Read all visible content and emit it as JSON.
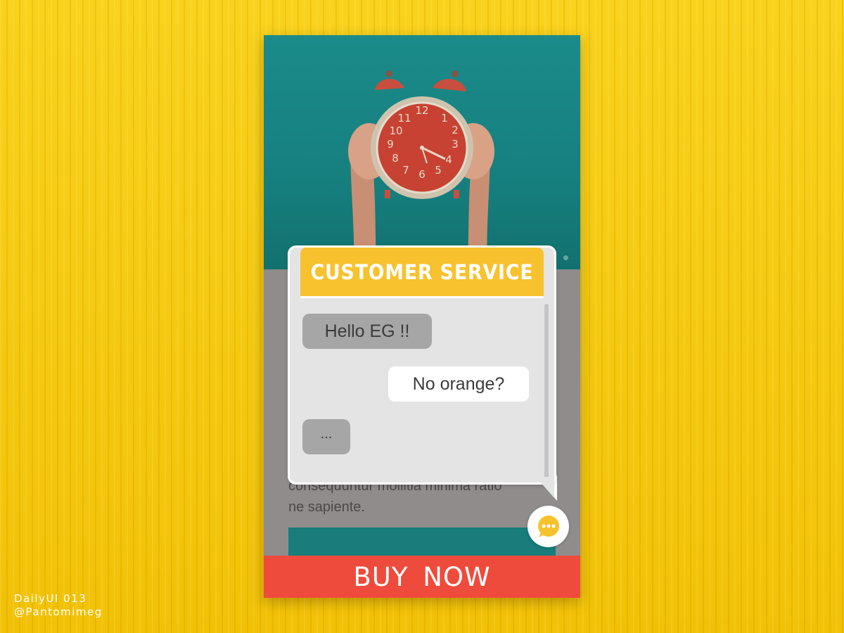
{
  "product": {
    "body_text_lines": [
      "consequuntur mollitia minima ratio",
      "ne sapiente."
    ],
    "buy_button_label": "BUY NOW",
    "hero_image": "alarm-clock-photo"
  },
  "customer_service": {
    "title": "CUSTOMER SERVICE",
    "messages": [
      {
        "from": "agent",
        "text": "Hello EG !!"
      },
      {
        "from": "user",
        "text": "No orange?"
      },
      {
        "from": "agent",
        "text": "..."
      }
    ],
    "fab_icon": "chat-bubble-icon"
  },
  "credit": {
    "line1": "DailyUI 013",
    "line2": "@Pantomimeg"
  },
  "colors": {
    "background_yellow": "#f7cb0a",
    "header_yellow": "#f7c22e",
    "buy_red": "#ef4b3c",
    "teal": "#1b8b8a"
  }
}
